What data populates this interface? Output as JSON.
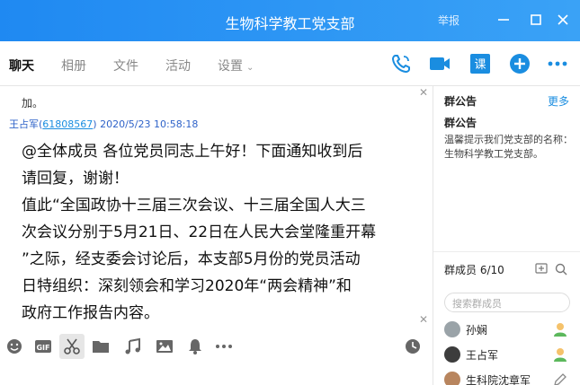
{
  "window": {
    "title": "生物科学教工党支部",
    "report": "举报",
    "minimize_icon": "minimize-icon",
    "maximize_icon": "maximize-icon",
    "close_icon": "close-icon"
  },
  "tabs": [
    {
      "label": "聊天",
      "active": true
    },
    {
      "label": "相册"
    },
    {
      "label": "文件"
    },
    {
      "label": "活动"
    },
    {
      "label": "设置"
    }
  ],
  "top_actions": {
    "call_icon": "phone-icon",
    "video_icon": "video-icon",
    "class_label": "课",
    "add_icon": "plus-icon",
    "more_icon": "more-icon"
  },
  "chat": {
    "prev_text": "加。",
    "sender_name": "王占军",
    "sender_qq": "61808567",
    "sender_time": "2020/5/23 10:58:18",
    "body_lines": [
      "@全体成员 各位党员同志上午好！下面通知收到后",
      "请回复，谢谢！",
      "值此“全国政协十三届三次会议、十三届全国人大三",
      "次会议分别于5月21日、22日在人民大会堂隆重开幕",
      "”之际，经支委会讨论后，本支部5月份的党员活动",
      "日特组织：深刻领会和学习2020年“两会精神”和",
      "政府工作报告内容。"
    ]
  },
  "toolbar_icons": [
    "emoji-icon",
    "gif-icon",
    "scissors-icon",
    "folder-icon",
    "music-icon",
    "image-icon",
    "bell-icon",
    "more-icon",
    "clock-icon"
  ],
  "toolbar_gif_label": "GIF",
  "announcement": {
    "heading": "群公告",
    "more": "更多",
    "subtitle": "群公告",
    "text": "温馨提示我们党支部的名称：生物科学教工党支部。"
  },
  "members": {
    "heading": "群成员 6/10",
    "search_placeholder": "搜索群成员",
    "list": [
      {
        "name": "孙娴",
        "role": "admin"
      },
      {
        "name": "王占军",
        "role": "owner"
      },
      {
        "name": "生科院沈章军",
        "role": "edit"
      }
    ]
  },
  "colors": {
    "titlebar": "#1f89f2",
    "accent": "#1a8de0",
    "owner_badge": "#f5a623",
    "admin_badge": "#5cb85c"
  }
}
